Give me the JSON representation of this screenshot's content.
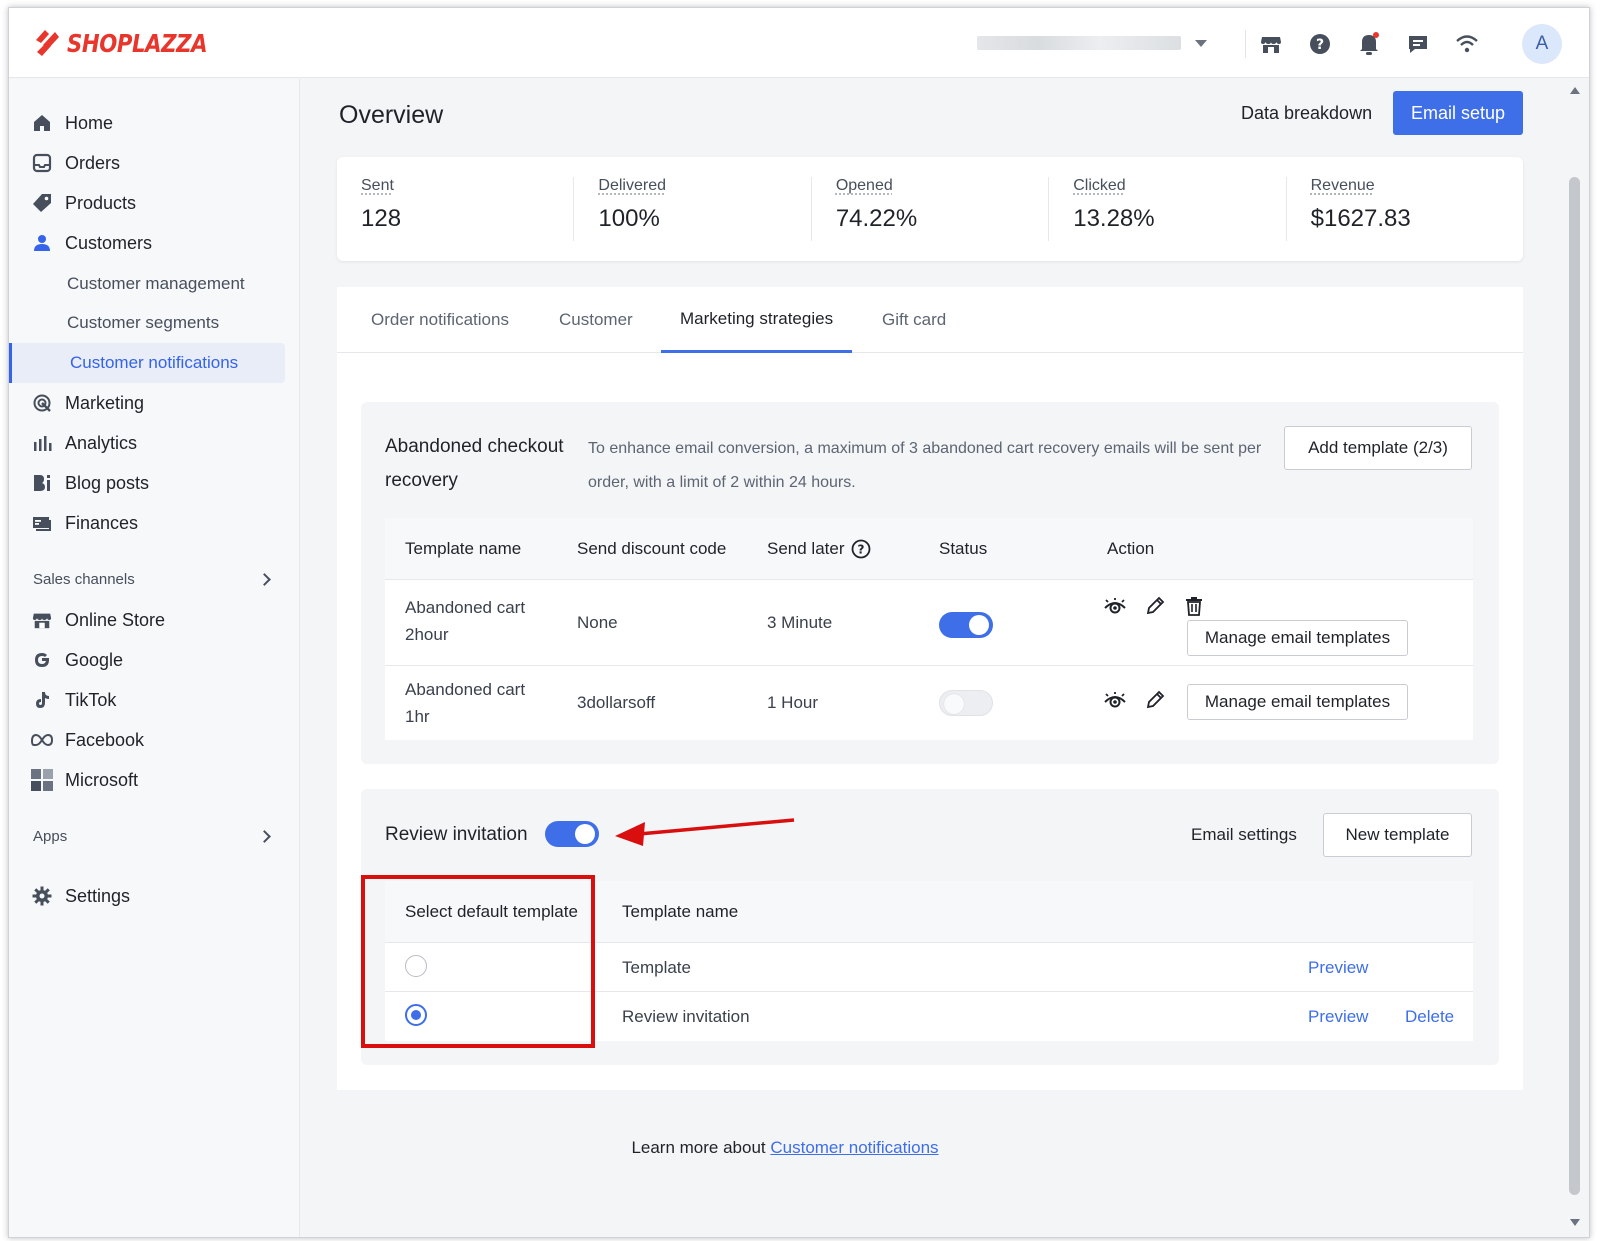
{
  "brand": {
    "name": "SHOPLAZZA",
    "color": "#e8362d",
    "accent": "#3e6ee8"
  },
  "topbar": {
    "avatar_letter": "A",
    "icons": [
      "store-icon",
      "help-icon",
      "bell-icon",
      "chat-icon",
      "wifi-icon"
    ]
  },
  "sidebar": {
    "items": [
      {
        "label": "Home",
        "icon": "home-icon"
      },
      {
        "label": "Orders",
        "icon": "orders-icon"
      },
      {
        "label": "Products",
        "icon": "tag-icon"
      },
      {
        "label": "Customers",
        "icon": "user-icon"
      }
    ],
    "customer_sub": [
      "Customer management",
      "Customer segments",
      "Customer notifications"
    ],
    "items2": [
      {
        "label": "Marketing",
        "icon": "marketing-icon"
      },
      {
        "label": "Analytics",
        "icon": "analytics-icon"
      },
      {
        "label": "Blog posts",
        "icon": "blog-icon"
      },
      {
        "label": "Finances",
        "icon": "finances-icon"
      }
    ],
    "sales_channels_label": "Sales channels",
    "channels": [
      {
        "label": "Online Store",
        "icon": "store-icon"
      },
      {
        "label": "Google",
        "icon": "google-icon"
      },
      {
        "label": "TikTok",
        "icon": "tiktok-icon"
      },
      {
        "label": "Facebook",
        "icon": "meta-icon"
      },
      {
        "label": "Microsoft",
        "icon": "microsoft-icon"
      }
    ],
    "apps_label": "Apps",
    "settings_label": "Settings"
  },
  "header": {
    "title": "Overview",
    "data_breakdown": "Data breakdown",
    "email_setup": "Email setup"
  },
  "stats": [
    {
      "label": "Sent",
      "value": "128"
    },
    {
      "label": "Delivered",
      "value": "100%"
    },
    {
      "label": "Opened",
      "value": "74.22%"
    },
    {
      "label": "Clicked",
      "value": "13.28%"
    },
    {
      "label": "Revenue",
      "value": "$1627.83"
    }
  ],
  "tabs": [
    "Order notifications",
    "Customer",
    "Marketing strategies",
    "Gift card"
  ],
  "abandoned": {
    "title": "Abandoned checkout recovery",
    "description": "To enhance email conversion, a maximum of 3 abandoned cart recovery emails will be sent per order, with a limit of 2 within 24 hours.",
    "add_template": "Add template (2/3)",
    "columns": [
      "Template name",
      "Send discount code",
      "Send later",
      "Status",
      "Action"
    ],
    "rows": [
      {
        "name_line1": "Abandoned cart",
        "name_line2": "2hour",
        "discount": "None",
        "send_later": "3 Minute",
        "enabled": true,
        "manage": "Manage email templates"
      },
      {
        "name_line1": "Abandoned cart",
        "name_line2": "1hr",
        "discount": "3dollarsoff",
        "send_later": "1 Hour",
        "enabled": false,
        "manage": "Manage email templates"
      }
    ]
  },
  "review": {
    "title": "Review invitation",
    "enabled": true,
    "email_settings": "Email settings",
    "new_template": "New template",
    "columns": [
      "Select default template",
      "Template name"
    ],
    "rows": [
      {
        "name": "Template",
        "selected": false,
        "preview": "Preview",
        "delete": ""
      },
      {
        "name": "Review invitation",
        "selected": true,
        "preview": "Preview",
        "delete": "Delete"
      }
    ]
  },
  "footer": {
    "prefix": "Learn more about ",
    "link": "Customer notifications"
  }
}
